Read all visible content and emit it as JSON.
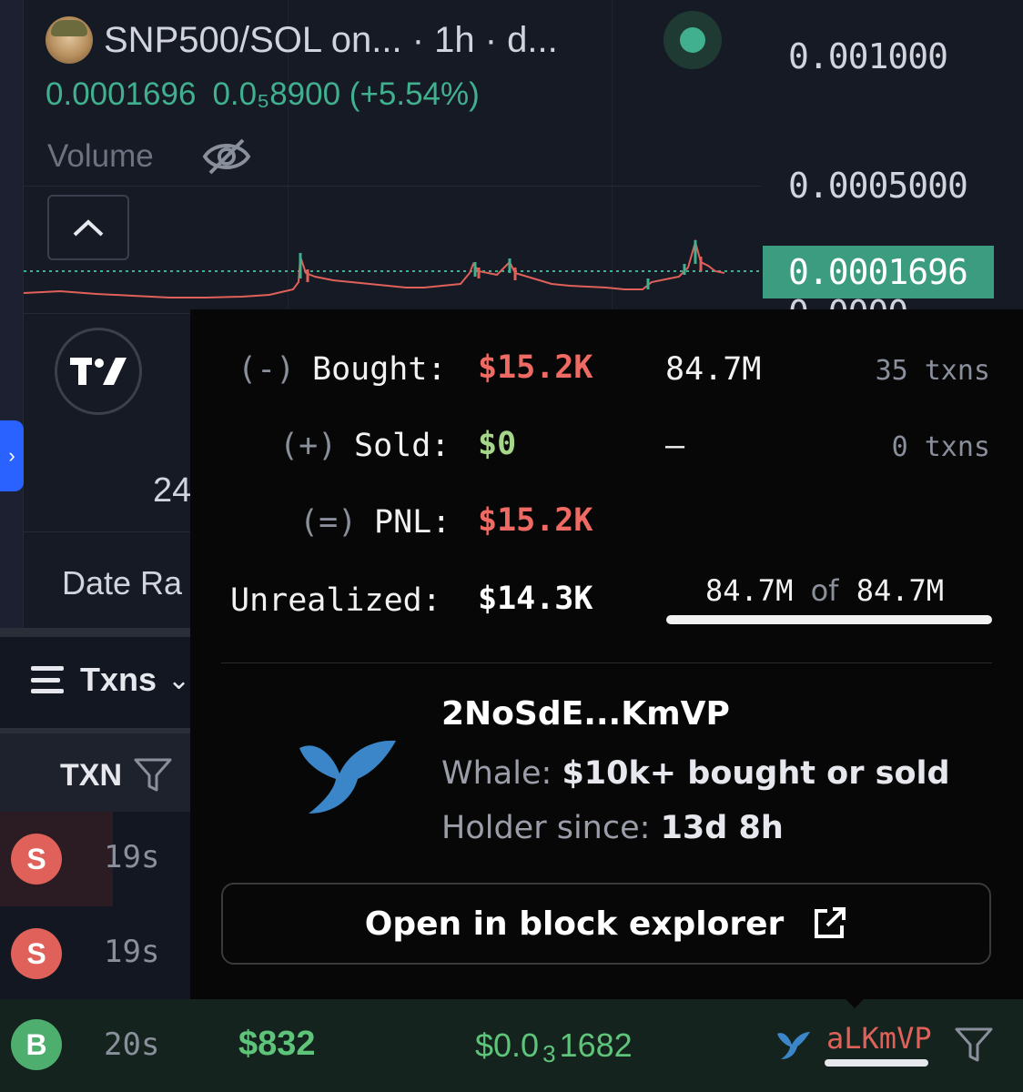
{
  "chart": {
    "symbol_title": "SNP500/SOL on...  · 1h · d...",
    "price": "0.0001696",
    "change": "0.0₅8900 (+5.54%)",
    "volume_label": "Volume",
    "axis_labels": [
      "0.001000",
      "0.0005000",
      "0.0000"
    ],
    "current_price_tag": "0.0001696",
    "partial_24": "24",
    "partial_date": "Date Ra",
    "icons": [
      "eye-off-icon",
      "chevron-up-icon",
      "tradingview-logo-icon",
      "chevron-right-icon"
    ],
    "colors": {
      "up": "#40b08f",
      "down": "#e0605a",
      "price_tag": "#3b9c80"
    }
  },
  "txns": {
    "tab_label": "Txns",
    "column_txn": "TXN",
    "rows": [
      {
        "type": "S",
        "age": "19s"
      },
      {
        "type": "S",
        "age": "19s"
      },
      {
        "type": "B",
        "age": "20s",
        "usd": "$832",
        "price_prefix": "$0.0",
        "price_zeros": "3",
        "price_rest": "1682",
        "maker": "aLKmVP"
      }
    ]
  },
  "popup": {
    "bought_prefix": "(-)",
    "bought_label": "Bought:",
    "bought_value": "$15.2K",
    "bought_tokens": "84.7M",
    "bought_txns": "35 txns",
    "sold_prefix": "(+)",
    "sold_label": "Sold:",
    "sold_value": "$0",
    "sold_tokens": "–",
    "sold_txns": "0 txns",
    "pnl_prefix": "(=)",
    "pnl_label": "PNL:",
    "pnl_value": "$15.2K",
    "unrealized_label": "Unrealized:",
    "unrealized_value": "$14.3K",
    "holding_amount": "84.7M",
    "holding_of": "of",
    "holding_total": "84.7M",
    "holding_fraction": 1.0,
    "wallet_address": "2NoSdE...KmVP",
    "whale_label": "Whale:",
    "whale_desc": "$10k+ bought or sold",
    "holder_label": "Holder since:",
    "holder_value": "13d 8h",
    "explorer_button": "Open in block explorer",
    "colors": {
      "loss": "#ef6a62",
      "gain": "#a6d68a",
      "background": "#070707"
    }
  }
}
